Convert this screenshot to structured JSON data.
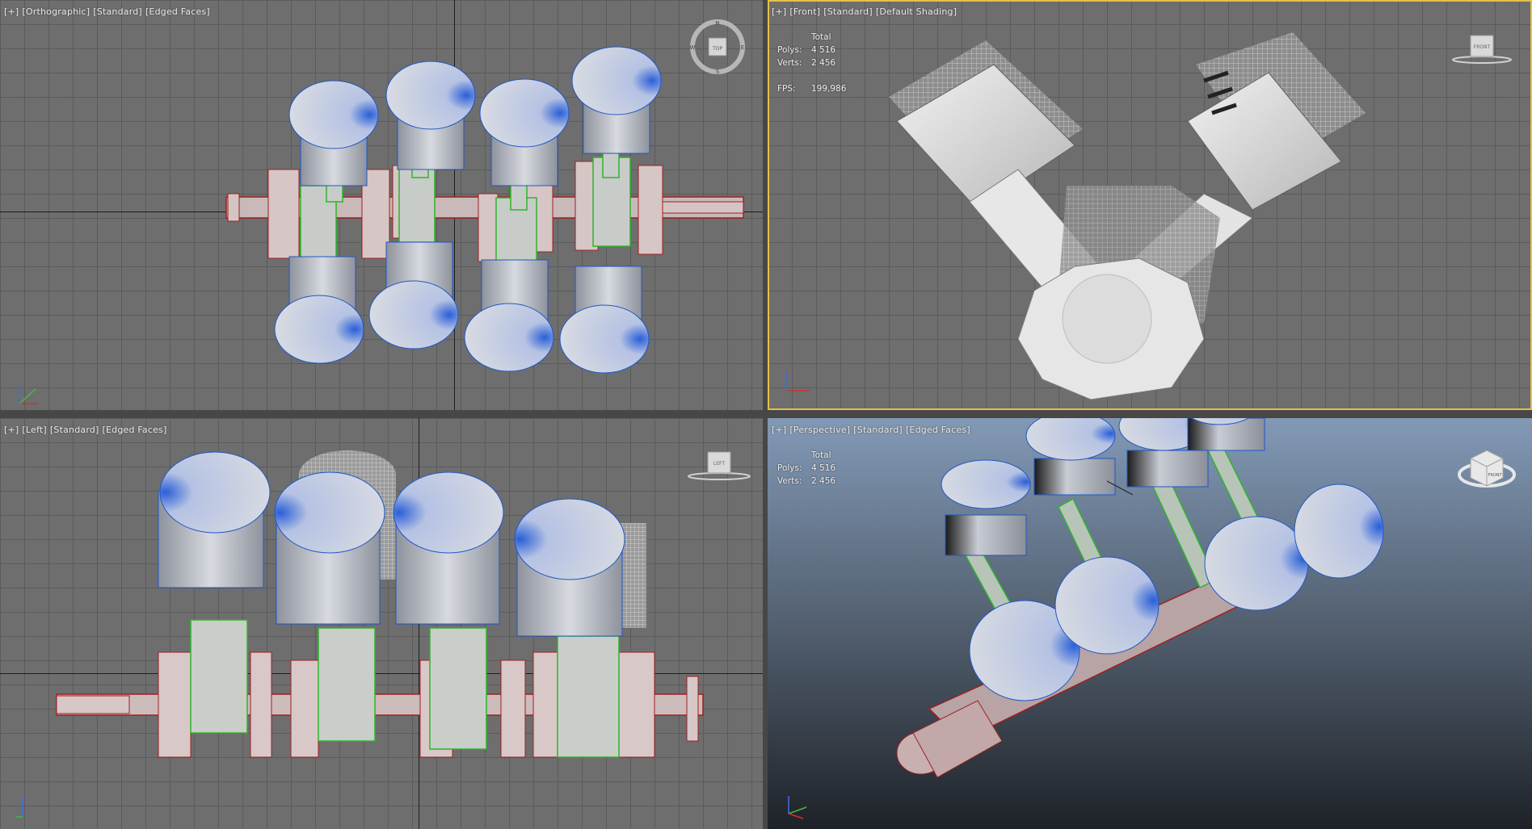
{
  "viewports": {
    "top_left": {
      "label": [
        "[+]",
        "[Orthographic]",
        "[Standard]",
        "[Edged Faces]"
      ],
      "viewcube": {
        "face": "TOP",
        "compass": [
          "N",
          "E",
          "S",
          "W"
        ]
      }
    },
    "top_right": {
      "label": [
        "[+]",
        "[Front]",
        "[Standard]",
        "[Default Shading]"
      ],
      "viewcube": {
        "face": "FRONT"
      },
      "stats": {
        "header": "Total",
        "polys_label": "Polys:",
        "polys_value": "4 516",
        "verts_label": "Verts:",
        "verts_value": "2 456",
        "fps_label": "FPS:",
        "fps_value": "199,986"
      }
    },
    "bottom_left": {
      "label": [
        "[+]",
        "[Left]",
        "[Standard]",
        "[Edged Faces]"
      ],
      "viewcube": {
        "face": "LEFT"
      }
    },
    "bottom_right": {
      "label": [
        "[+]",
        "[Perspective]",
        "[Standard]",
        "[Edged Faces]"
      ],
      "viewcube": {
        "face": "FRONT"
      },
      "stats": {
        "header": "Total",
        "polys_label": "Polys:",
        "polys_value": "4 516",
        "verts_label": "Verts:",
        "verts_value": "2 456"
      }
    }
  },
  "colors": {
    "piston_fill": "#b9bdc6",
    "piston_edge": "#1f57c6",
    "rod_edge": "#2fb42a",
    "crank_fill": "#c9b7b7",
    "crank_edge": "#a02020",
    "viewport_bg": "#6e6e6e",
    "grid_line": "#5b5b5b"
  }
}
